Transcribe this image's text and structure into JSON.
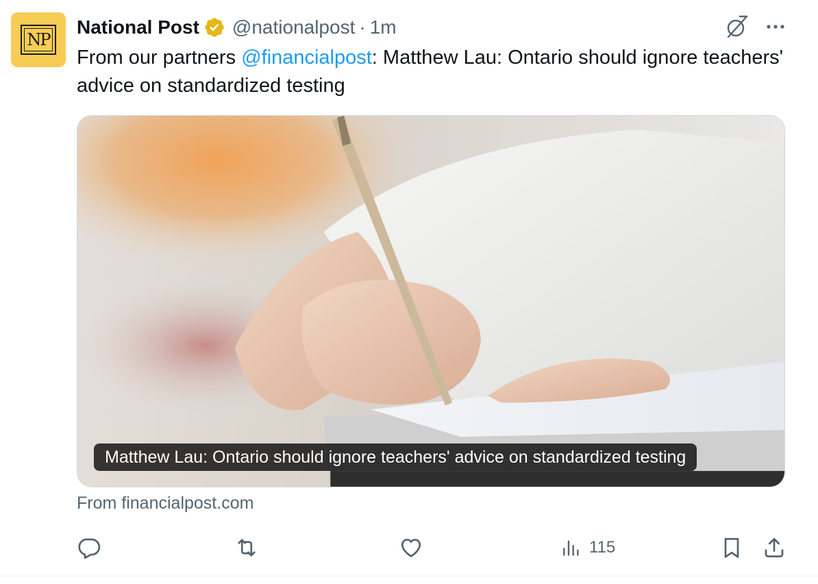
{
  "tweet": {
    "avatar_text": "NP",
    "display_name": "National Post",
    "handle": "@nationalpost",
    "separator": "·",
    "time": "1m",
    "text_before": "From our partners ",
    "mention": "@financialpost",
    "text_after": ": Matthew Lau: Ontario should ignore teachers' advice on standardized testing"
  },
  "card": {
    "caption": "Matthew Lau: Ontario should ignore teachers' advice on standardized testing",
    "source": "From financialpost.com"
  },
  "actions": {
    "views_count": "115"
  },
  "icons": {
    "verified": "verified-badge-icon",
    "grok": "grok-icon",
    "more": "more-options-icon",
    "reply": "reply-icon",
    "repost": "repost-icon",
    "like": "like-icon",
    "views": "views-icon",
    "bookmark": "bookmark-icon",
    "share": "share-icon"
  },
  "colors": {
    "accent": "#1d9bf0",
    "secondary_text": "#536471",
    "verified_gold": "#e2b719",
    "avatar_bg": "#f6cc55"
  }
}
